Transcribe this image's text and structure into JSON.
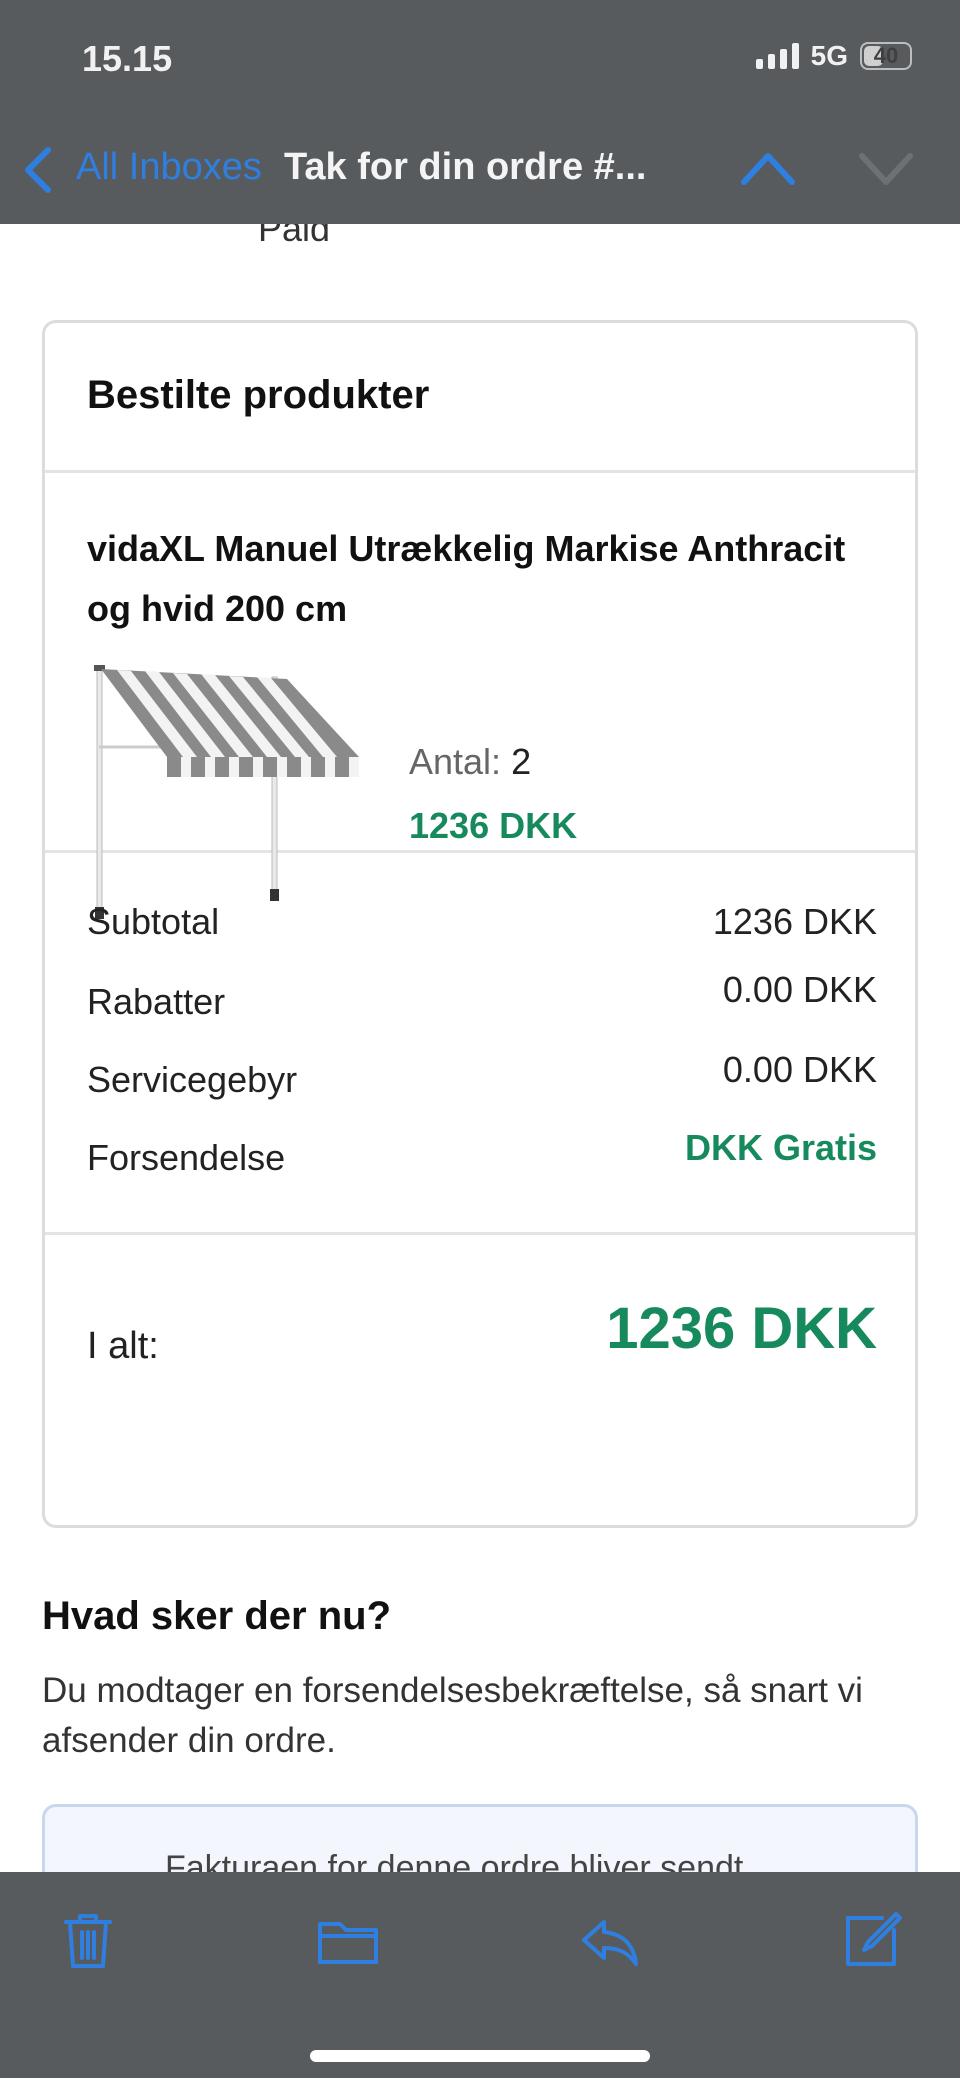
{
  "status_bar": {
    "time": "15.15",
    "network": "5G",
    "battery": "40"
  },
  "nav": {
    "back_label": "All Inboxes",
    "title": "Tak for din ordre #..."
  },
  "email": {
    "paid_text": "Paid",
    "order_card": {
      "title": "Bestilte produkter",
      "product": {
        "name": "vidaXL Manuel Utrækkelig Markise Anthracit og hvid 200 cm",
        "quantity_label": "Antal:",
        "quantity_value": "2",
        "price": "1236 DKK"
      },
      "totals": [
        {
          "label": "Subtotal",
          "value": "1236 DKK"
        },
        {
          "label": "Rabatter",
          "value": "0.00 DKK"
        },
        {
          "label": "Servicegebyr",
          "value": "0.00 DKK"
        },
        {
          "label": "Forsendelse",
          "value": "DKK Gratis"
        }
      ],
      "grand_total_label": "I alt:",
      "grand_total_value": "1236 DKK"
    },
    "next_steps": {
      "title": "Hvad sker der nu?",
      "text": "Du modtager en forsendelsesbekræftelse, så snart vi afsender din ordre."
    },
    "invoice_note": "Fakturaen for denne ordre bliver sendt"
  },
  "toolbar": {
    "icons": [
      "trash-icon",
      "folder-icon",
      "reply-icon",
      "compose-icon"
    ]
  },
  "colors": {
    "accent_blue": "#2f7fe0",
    "price_green": "#168a5c",
    "bar_gray": "#585b5e"
  }
}
